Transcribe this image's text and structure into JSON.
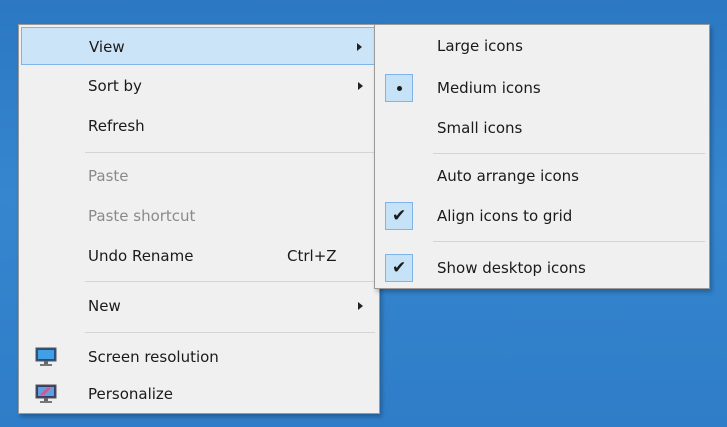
{
  "main_menu": {
    "items": [
      {
        "label": "View",
        "has_submenu": true,
        "highlighted": true
      },
      {
        "label": "Sort by",
        "has_submenu": true
      },
      {
        "label": "Refresh"
      },
      {
        "label": "Paste",
        "disabled": true
      },
      {
        "label": "Paste shortcut",
        "disabled": true
      },
      {
        "label": "Undo Rename",
        "shortcut": "Ctrl+Z"
      },
      {
        "label": "New",
        "has_submenu": true
      },
      {
        "label": "Screen resolution",
        "icon": "display-icon"
      },
      {
        "label": "Personalize",
        "icon": "personalize-icon"
      }
    ]
  },
  "view_submenu": {
    "items": [
      {
        "label": "Large icons"
      },
      {
        "label": "Medium icons",
        "selected": true,
        "indicator": "radio-dot"
      },
      {
        "label": "Small icons"
      },
      {
        "label": "Auto arrange icons"
      },
      {
        "label": "Align icons to grid",
        "checked": true
      },
      {
        "label": "Show desktop icons",
        "checked": true
      }
    ]
  },
  "colors": {
    "desktop_background": "#2f7fc8",
    "menu_background": "#f0f0f0",
    "highlight_background": "#cce4f7",
    "highlight_border": "#7eb4ea",
    "disabled_text": "#8a8a8a"
  }
}
